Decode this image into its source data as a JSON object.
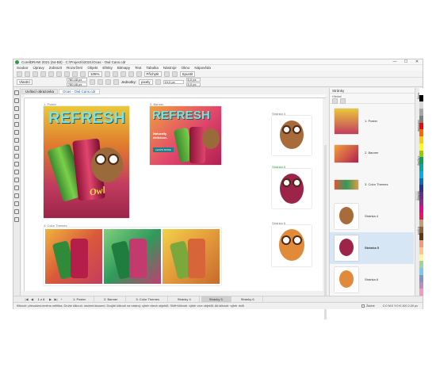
{
  "window": {
    "title": "CorelDRAW 2021 (64-Bit) - C:\\Projects\\2021\\Ocas - Owl Cans.cdr",
    "minimize": "—",
    "maximize": "☐",
    "close": "✕"
  },
  "menu": [
    "Soubor",
    "Úpravy",
    "Zobrazit",
    "Rozvržení",
    "Objekt",
    "Efekty",
    "Bitmapy",
    "Text",
    "Tabulka",
    "Nástroje",
    "Okno",
    "Nápověda"
  ],
  "toolbar1": {
    "zoom": "105%",
    "snap_label": "Přichytit",
    "launch_label": "Spustit"
  },
  "toolbar2": {
    "preset": "Vlastní",
    "width": "780,48 px",
    "height": "780,48 px",
    "units_label": "Jednotky:",
    "units": "pixely",
    "nudge": "10,0 px",
    "dup_x": "5,0 px",
    "dup_y": "5,0 px"
  },
  "doc_tabs": [
    {
      "label": "Uvítací obrazovka"
    },
    {
      "label": "Ocas - Owl Cans.cdr"
    }
  ],
  "canvas": {
    "page_labels": {
      "poster": "1. Poster",
      "banner": "2. Banner",
      "themes": "3. Color Themes",
      "p4": "Stránka 4",
      "p5": "Stránka 5",
      "p6": "Stránka 6"
    },
    "poster_title": "REFRESH",
    "banner_title": "REFRESH",
    "banner_tagline": "Naturally delicious.",
    "banner_cta": "LEARN MORE",
    "can_text": "Owl"
  },
  "pages_panel": {
    "title": "Stránky",
    "subtitle": "Hledat",
    "items": [
      {
        "label": "1. Poster"
      },
      {
        "label": "2. Banner"
      },
      {
        "label": "3. Color Themes"
      },
      {
        "label": "Stránka 4"
      },
      {
        "label": "Stránka 5"
      },
      {
        "label": "Stránka 6"
      }
    ]
  },
  "side_tabs": [
    "Rady",
    "Vlastnosti",
    "Objekty",
    "Stránky",
    "Export"
  ],
  "palette": [
    "#ffffff",
    "#000000",
    "#d9d9d9",
    "#a6a6a6",
    "#7f7f7f",
    "#ff0000",
    "#ff6600",
    "#ffcc00",
    "#ffff00",
    "#99cc00",
    "#00a651",
    "#00a99d",
    "#00aeef",
    "#0072bc",
    "#2e3192",
    "#662d91",
    "#92278f",
    "#ec008c",
    "#ed145b",
    "#c69c6d",
    "#8c6239",
    "#603913",
    "#f7977a",
    "#fdc689",
    "#fff799",
    "#a3d39c",
    "#6dcff6",
    "#8493ca",
    "#bd8cbf",
    "#f49ac1"
  ],
  "page_nav": {
    "first": "|◀",
    "prev": "◀",
    "counter": "1 z 6",
    "next": "▶",
    "last": "▶|",
    "add": "+"
  },
  "page_tabs": [
    "1: Poster",
    "2: Banner",
    "3: Color Themes",
    "Stránky 4",
    "Stránky 5",
    "Stránky 6"
  ],
  "status": {
    "hint": "Kliknutí: přesušení/změna měřítka; Druhé kliknutí: otočení/zkosení; Dvojité kliknutí na nástroj: výběr všech objektů; Shift+kliknutí: výběr více objektů; Alt-kliknutí: výběr dolů",
    "fill": "Žádné",
    "outline": "C:0 M:0 Y:0 K:100  2,00 px"
  }
}
